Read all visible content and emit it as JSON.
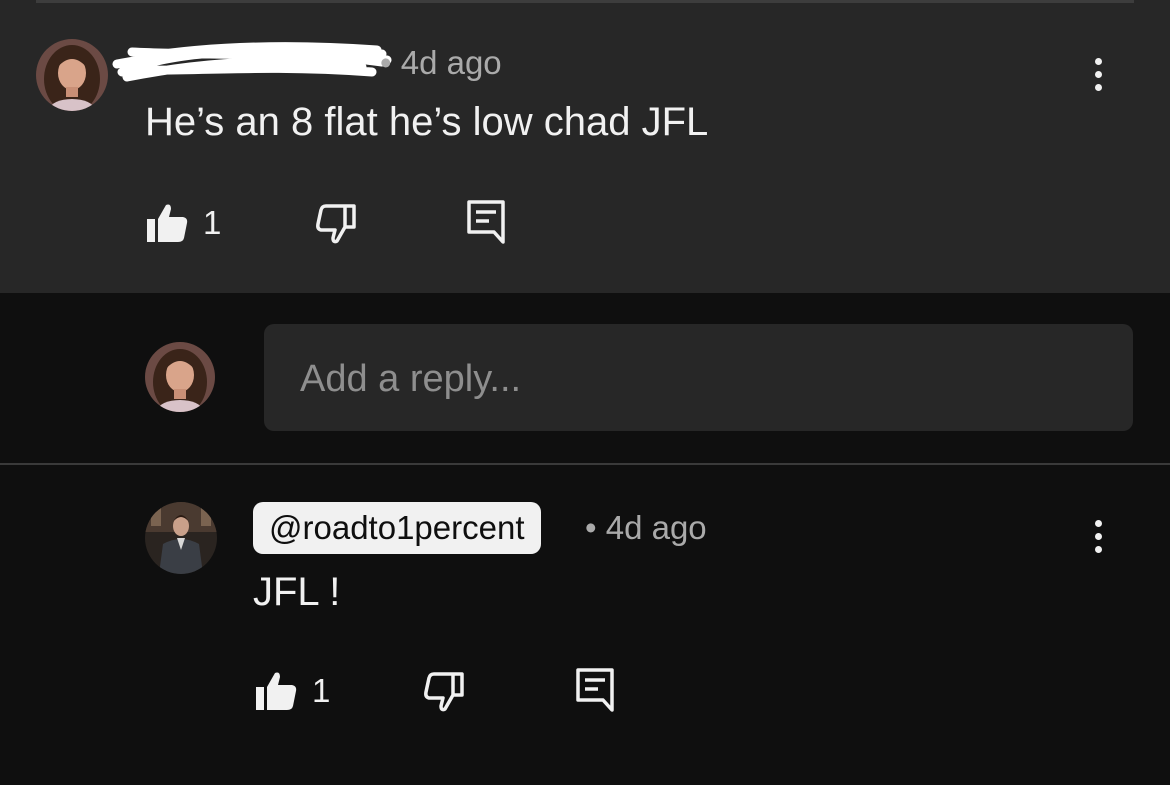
{
  "comment": {
    "meta": "• 4d ago",
    "text": "He’s an 8 flat he’s low chad JFL",
    "like_count": "1"
  },
  "reply_input": {
    "placeholder": "Add a reply..."
  },
  "reply": {
    "author": "@roadto1percent",
    "meta": "• 4d ago",
    "text": "JFL !",
    "like_count": "1"
  },
  "icons": [
    "like-icon",
    "dislike-icon",
    "reply-icon",
    "more-options-icon"
  ],
  "colors": {
    "comment_bg": "#272727",
    "page_bg": "#0f0f0f",
    "text": "#f1f1f1",
    "meta": "#aaaaaa"
  }
}
